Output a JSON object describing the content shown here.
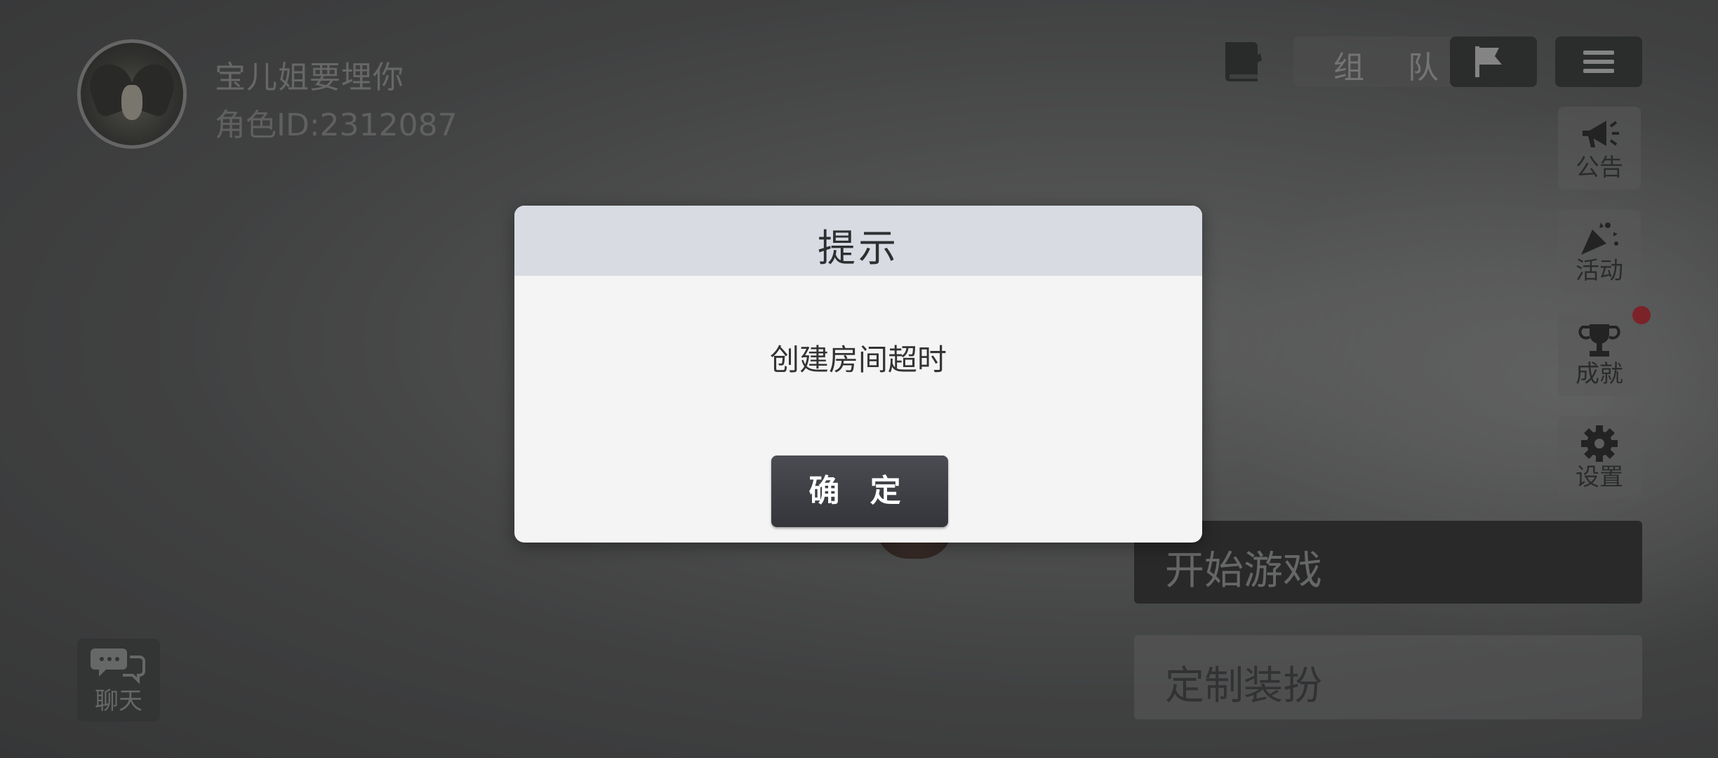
{
  "profile": {
    "username": "宝儿姐要埋你",
    "role_id": "角色ID:2312087"
  },
  "top_bar": {
    "team_label": "组 队",
    "icons": [
      "book-icon",
      "flag-icon",
      "menu-icon"
    ]
  },
  "side_menu": [
    {
      "label": "公告",
      "icon": "megaphone-icon"
    },
    {
      "label": "活动",
      "icon": "party-popper-icon"
    },
    {
      "label": "成就",
      "icon": "trophy-icon",
      "badge": true
    },
    {
      "label": "设置",
      "icon": "gear-icon"
    }
  ],
  "actions": {
    "start_game": "开始游戏",
    "custom_outfit": "定制装扮"
  },
  "chat": {
    "label": "聊天",
    "icon": "chat-bubbles-icon"
  },
  "dialog": {
    "title": "提示",
    "message": "创建房间超时",
    "confirm": "确 定"
  },
  "colors": {
    "dialog_header": "#d8dce2",
    "dialog_body": "#f4f4f4",
    "confirm_button": "#3a3b40",
    "badge_red": "#c0202a"
  }
}
